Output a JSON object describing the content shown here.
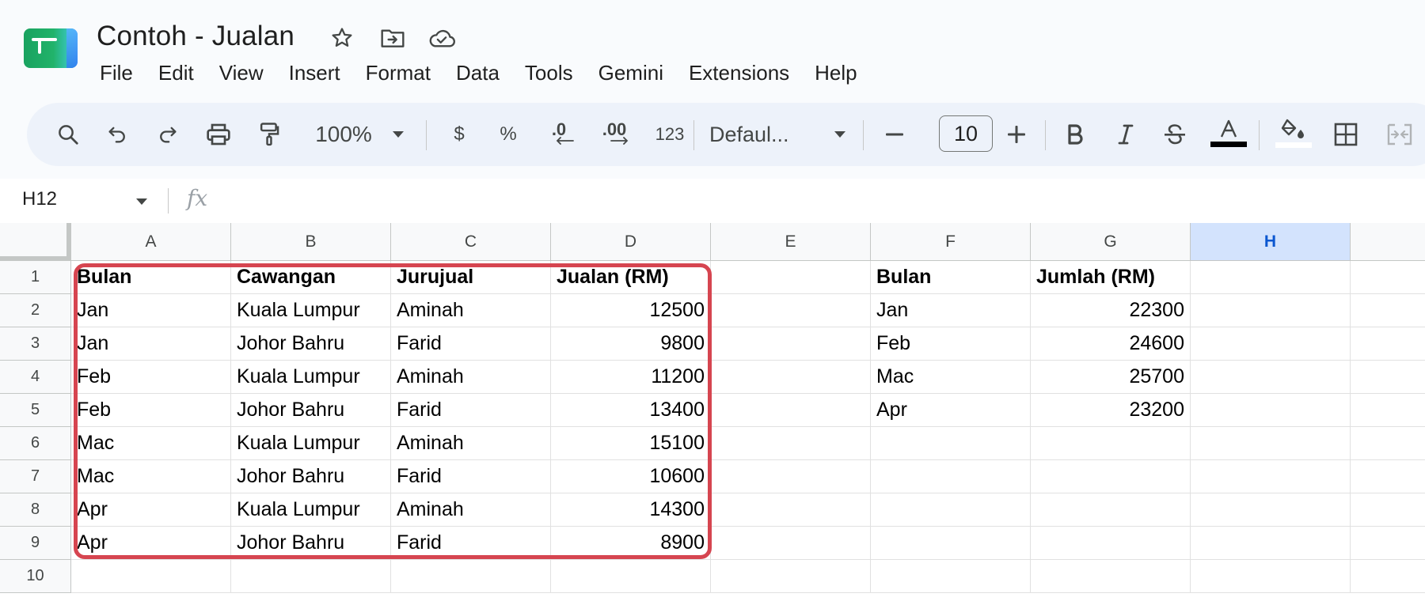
{
  "document": {
    "title": "Contoh - Jualan"
  },
  "menu": [
    "File",
    "Edit",
    "View",
    "Insert",
    "Format",
    "Data",
    "Tools",
    "Gemini",
    "Extensions",
    "Help"
  ],
  "toolbar": {
    "zoom": "100%",
    "currency": "$",
    "percent": "%",
    "decrease_decimal": ".0",
    "increase_decimal": ".00",
    "number_format": "123",
    "font": "Defaul...",
    "font_size": "10",
    "colors": {
      "text_color_bar": "#000000",
      "fill_color_bar": "#ffffff"
    }
  },
  "formula_bar": {
    "cell_ref": "H12",
    "fx": "fx"
  },
  "grid": {
    "columns": [
      "A",
      "B",
      "C",
      "D",
      "E",
      "F",
      "G",
      "H"
    ],
    "selected_column": "H",
    "rows": [
      "1",
      "2",
      "3",
      "4",
      "5",
      "6",
      "7",
      "8",
      "9",
      "10"
    ],
    "cells": [
      [
        "Bulan",
        "Cawangan",
        "Jurujual",
        "Jualan (RM)",
        "",
        "Bulan",
        "Jumlah (RM)",
        ""
      ],
      [
        "Jan",
        "Kuala Lumpur",
        "Aminah",
        "12500",
        "",
        "Jan",
        "22300",
        ""
      ],
      [
        "Jan",
        "Johor Bahru",
        "Farid",
        "9800",
        "",
        "Feb",
        "24600",
        ""
      ],
      [
        "Feb",
        "Kuala Lumpur",
        "Aminah",
        "11200",
        "",
        "Mac",
        "25700",
        ""
      ],
      [
        "Feb",
        "Johor Bahru",
        "Farid",
        "13400",
        "",
        "Apr",
        "23200",
        ""
      ],
      [
        "Mac",
        "Kuala Lumpur",
        "Aminah",
        "15100",
        "",
        "",
        "",
        ""
      ],
      [
        "Mac",
        "Johor Bahru",
        "Farid",
        "10600",
        "",
        "",
        "",
        ""
      ],
      [
        "Apr",
        "Kuala Lumpur",
        "Aminah",
        "14300",
        "",
        "",
        "",
        ""
      ],
      [
        "Apr",
        "Johor Bahru",
        "Farid",
        "8900",
        "",
        "",
        "",
        ""
      ],
      [
        "",
        "",
        "",
        "",
        "",
        "",
        "",
        ""
      ]
    ],
    "highlight_color": "#d64550"
  }
}
